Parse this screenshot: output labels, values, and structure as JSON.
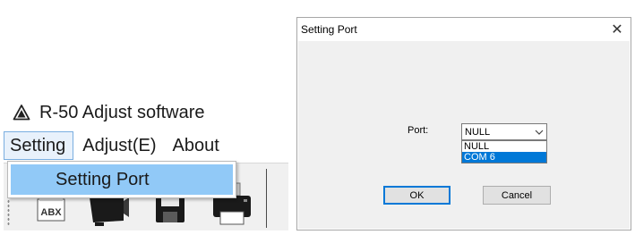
{
  "app": {
    "title": "R-50 Adjust software",
    "title_icon": "warning-triangle-icon"
  },
  "menubar": {
    "items": [
      {
        "label": "Setting",
        "active": true
      },
      {
        "label": "Adjust(E)",
        "active": false
      },
      {
        "label": "About",
        "active": false
      }
    ]
  },
  "setting_menu": {
    "items": [
      "Setting Port"
    ]
  },
  "toolbar": {
    "icons": [
      "abx-icon",
      "camera-icon",
      "save-icon",
      "printer-icon"
    ]
  },
  "dialog": {
    "title": "Setting Port",
    "close_glyph": "✕",
    "port_label": "Port:",
    "port_value": "NULL",
    "port_options": [
      "NULL",
      "COM 6"
    ],
    "selected_option": "COM 6",
    "ok_label": "OK",
    "cancel_label": "Cancel"
  },
  "colors": {
    "menu_highlight": "#91c9f7",
    "list_selection": "#0078d7",
    "dialog_client": "#f0f0f0"
  }
}
